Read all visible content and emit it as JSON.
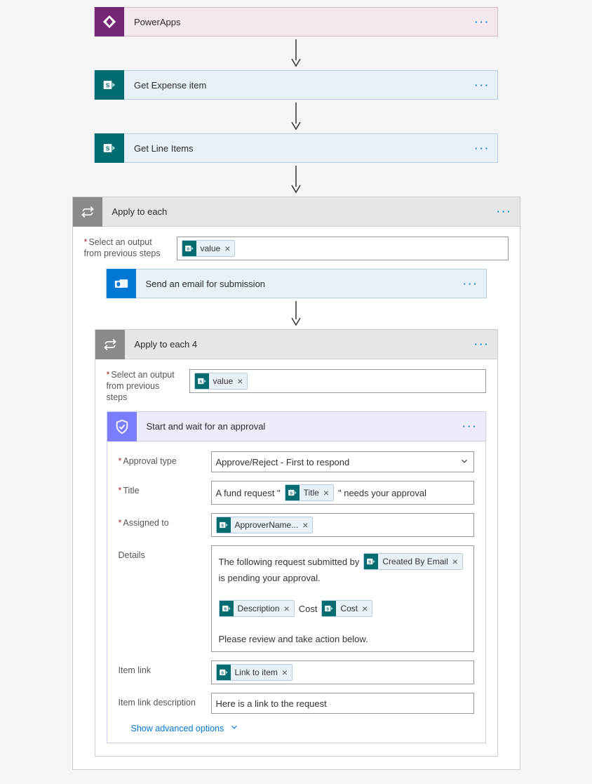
{
  "steps": {
    "powerapps": {
      "title": "PowerApps"
    },
    "get_expense": {
      "title": "Get Expense item"
    },
    "get_line_items": {
      "title": "Get Line Items"
    }
  },
  "apply1": {
    "title": "Apply to each",
    "select_label_l1": "Select an output",
    "select_label_l2": "from previous steps",
    "value_token": "value",
    "email_step": {
      "title": "Send an email for submission"
    }
  },
  "apply2": {
    "title": "Apply to each 4",
    "select_label_l1": "Select an output",
    "select_label_l2": "from previous steps",
    "value_token": "value"
  },
  "approval": {
    "title": "Start and wait for an approval",
    "fields": {
      "approval_type_label": "Approval type",
      "approval_type_value": "Approve/Reject - First to respond",
      "title_label": "Title",
      "title_pre": "A fund request \"",
      "title_token": "Title",
      "title_post": "\" needs your approval",
      "assigned_label": "Assigned to",
      "assigned_token": "ApproverName...",
      "details_label": "Details",
      "details_pre": "The following request submitted by",
      "details_created_token": "Created By Email",
      "details_mid": "is pending your approval.",
      "details_desc_token": "Description",
      "details_cost_label": "Cost",
      "details_cost_token": "Cost",
      "details_footer": "Please review and take action below.",
      "item_link_label": "Item link",
      "item_link_token": "Link to item",
      "item_link_desc_label": "Item link description",
      "item_link_desc_value": "Here is a link to the request"
    },
    "advanced": "Show advanced options"
  }
}
